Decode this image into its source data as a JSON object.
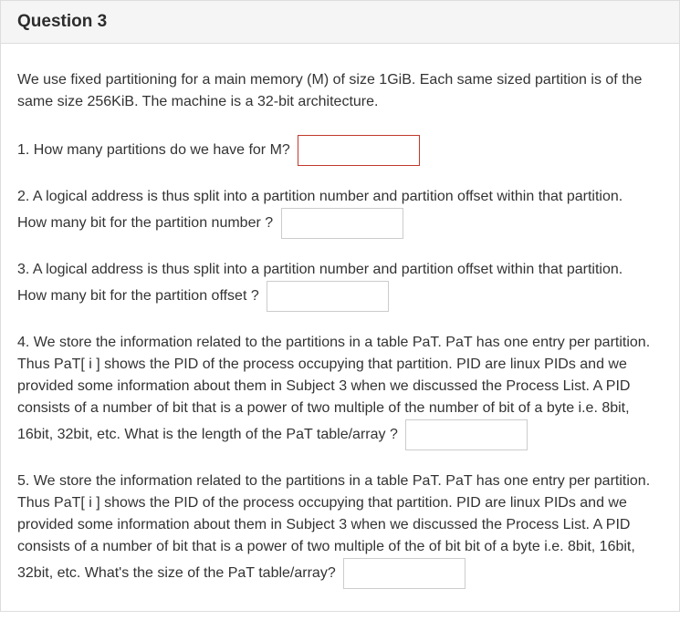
{
  "header": {
    "title": "Question 3"
  },
  "intro": "We use fixed partitioning for a main memory (M) of size 1GiB. Each same sized partition is of the same size 256KiB. The machine is a 32-bit architecture.",
  "q1": {
    "text": "1. How many partitions do we have for  M?",
    "value": ""
  },
  "q2": {
    "line1": "2. A logical address is thus split into a partition number and partition offset within that partition.",
    "line2": "How many bit for the partition number ?",
    "value": ""
  },
  "q3": {
    "line1": "3. A logical address is thus split into a partition number and partition offset within that partition.",
    "line2": "How many bit for the partition offset ?",
    "value": ""
  },
  "q4": {
    "text": "4. We store the information related to the partitions in a table PaT. PaT has one entry per partition. Thus PaT[ i ] shows the PID of the process occupying that partition. PID are linux PIDs and we provided some information about them in Subject 3 when we discussed the Process List. A PID consists of a number of bit that is a power of two multiple of the number of bit of a byte i.e. 8bit,",
    "tail": "16bit, 32bit, etc. What is the length of the  PaT table/array ?",
    "value": ""
  },
  "q5": {
    "text": "5. We store the information related to the partitions in a table PaT. PaT has one entry per partition. Thus PaT[  i ]  shows the PID of the process occupying that partition. PID are linux PIDs and we provided some information about them in Subject 3 when we discussed the Process List. A PID consists of a number of bit that is a power of two multiple of the of bit bit of a byte i.e. 8bit, 16bit,",
    "tail": "32bit, etc.  What's the size   of the  PaT table/array?",
    "value": ""
  }
}
